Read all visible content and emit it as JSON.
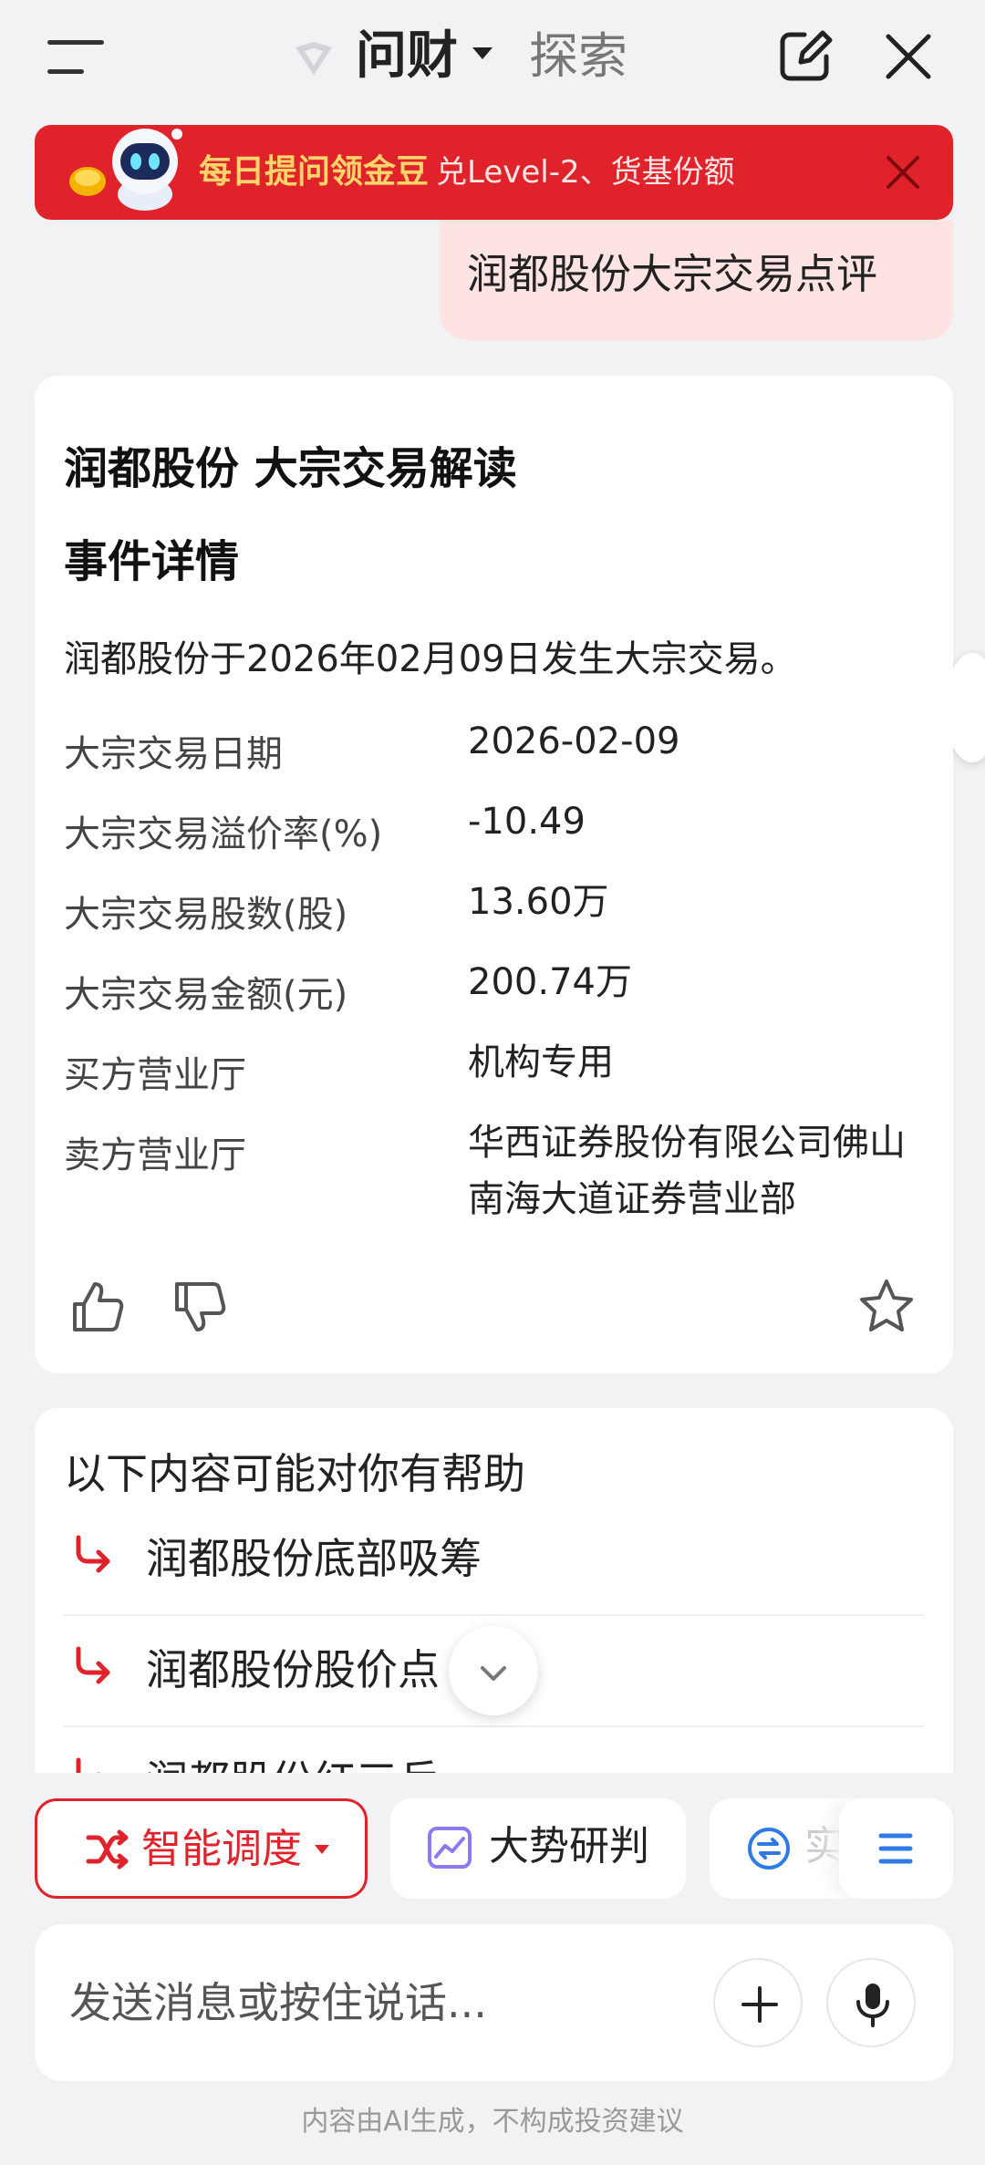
{
  "header": {
    "title": "问财",
    "tab_explore": "探索"
  },
  "banner": {
    "main": "每日提问领金豆",
    "sub": "兑Level-2、货基份额"
  },
  "user_message": "润都股份大宗交易点评",
  "answer": {
    "title": "润都股份 大宗交易解读",
    "section": "事件详情",
    "summary": "润都股份于2026年02月09日发生大宗交易。",
    "rows": [
      {
        "label": "大宗交易日期",
        "value": "2026-02-09"
      },
      {
        "label": "大宗交易溢价率(%)",
        "value": "-10.49"
      },
      {
        "label": "大宗交易股数(股)",
        "value": "13.60万"
      },
      {
        "label": "大宗交易金额(元)",
        "value": "200.74万"
      },
      {
        "label": "买方营业厅",
        "value": "机构专用"
      },
      {
        "label": "卖方营业厅",
        "value": "华西证券股份有限公司佛山南海大道证券营业部"
      }
    ]
  },
  "suggestions": {
    "title": "以下内容可能对你有帮助",
    "items": [
      "润都股份底部吸筹",
      "润都股份股价点",
      "润都股份红三兵"
    ]
  },
  "tools": {
    "smart": "智能调度",
    "trend": "大势研判",
    "third": "实"
  },
  "input": {
    "placeholder": "发送消息或按住说话..."
  },
  "footer": "内容由AI生成，不构成投资建议",
  "colors": {
    "accent": "#e0232a",
    "bubble": "#fde4e2",
    "banner_text": "#ffd46a"
  }
}
